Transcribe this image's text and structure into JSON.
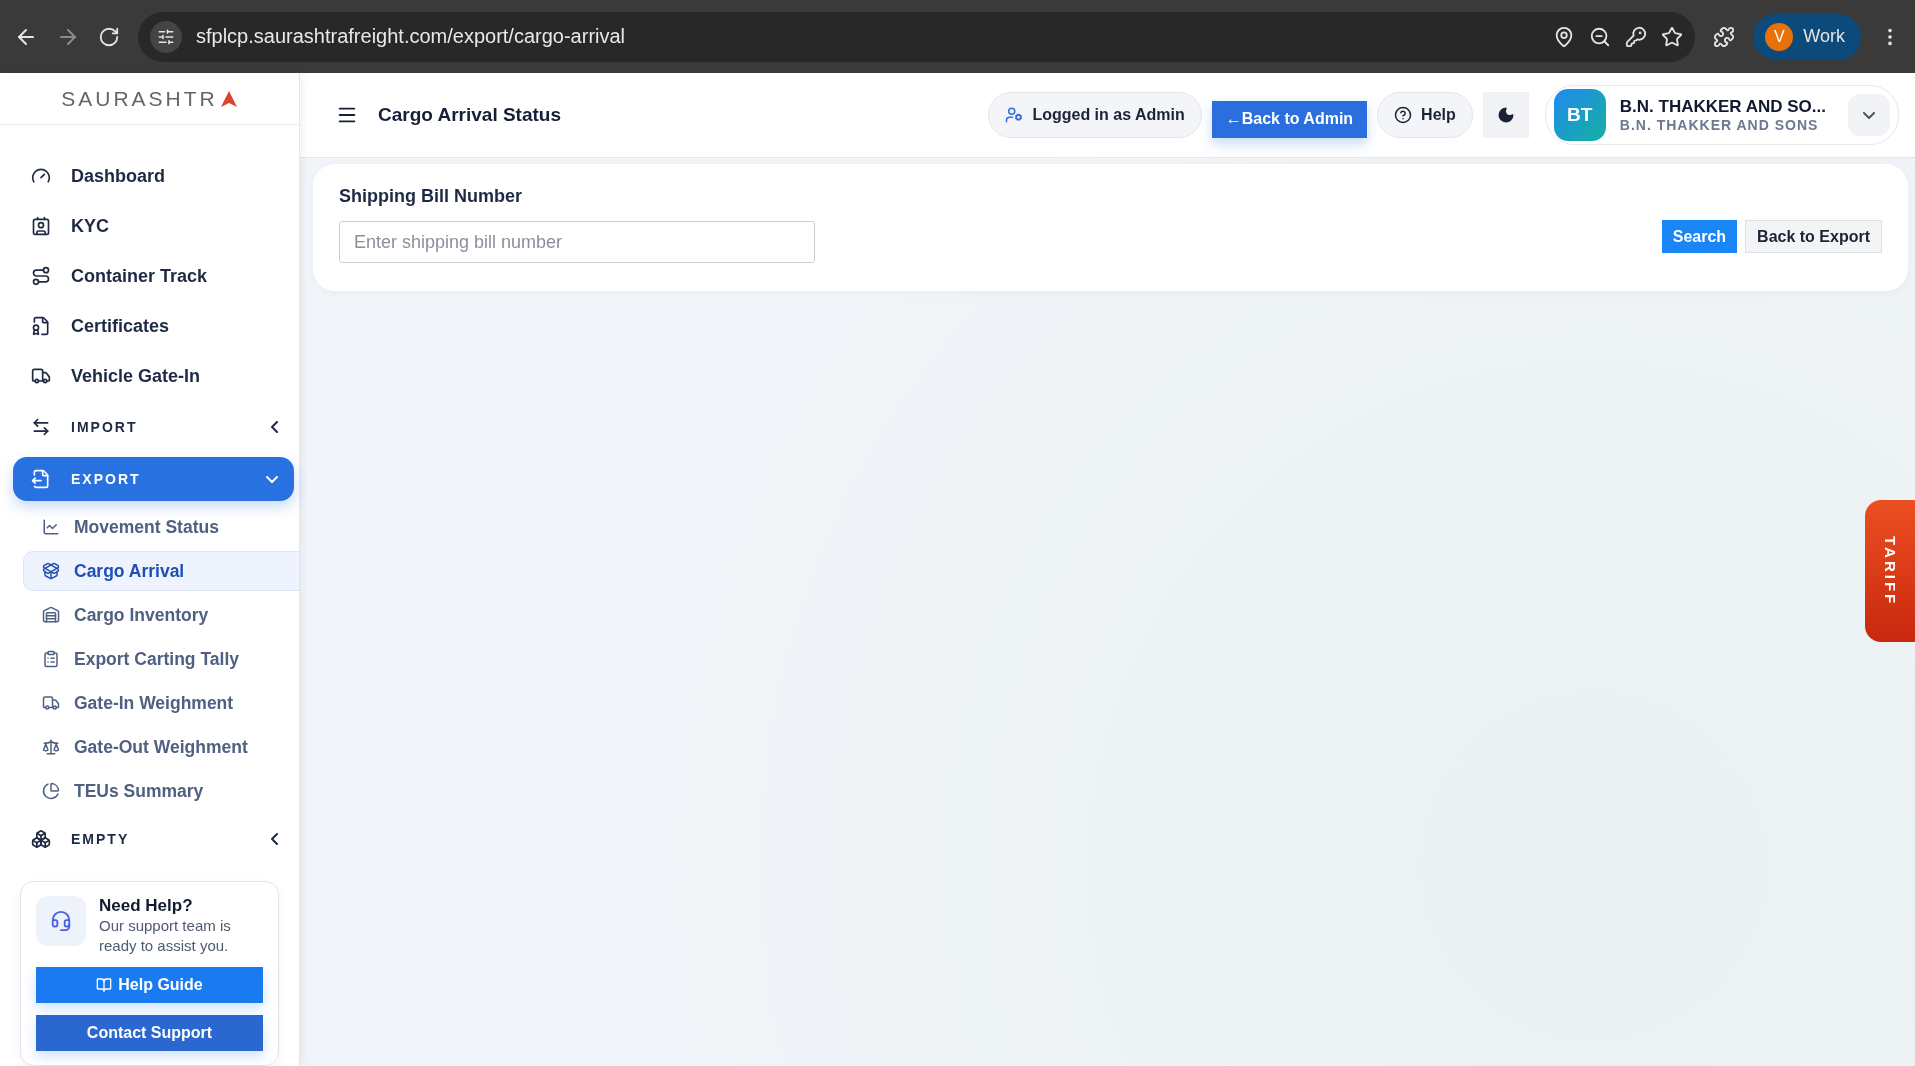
{
  "browser": {
    "url": "sfplcp.saurashtrafreight.com/export/cargo-arrival",
    "profile_initial": "V",
    "profile_name": "Work"
  },
  "sidebar": {
    "logo": "SAURASHTR",
    "items": [
      {
        "kind": "link",
        "label": "Dashboard",
        "selected": false
      },
      {
        "kind": "link",
        "label": "KYC",
        "selected": false
      },
      {
        "kind": "link",
        "label": "Container Track",
        "selected": false
      },
      {
        "kind": "link",
        "label": "Certificates",
        "selected": false
      },
      {
        "kind": "link",
        "label": "Vehicle Gate-In",
        "selected": false
      },
      {
        "kind": "section",
        "label": "IMPORT",
        "selected": false,
        "expanded": false
      },
      {
        "kind": "section",
        "label": "EXPORT",
        "selected": true,
        "expanded": true,
        "children": [
          {
            "label": "Movement Status",
            "selected": false
          },
          {
            "label": "Cargo Arrival",
            "selected": true
          },
          {
            "label": "Cargo Inventory",
            "selected": false
          },
          {
            "label": "Export Carting Tally",
            "selected": false
          },
          {
            "label": "Gate-In Weighment",
            "selected": false
          },
          {
            "label": "Gate-Out Weighment",
            "selected": false
          },
          {
            "label": "TEUs Summary",
            "selected": false
          }
        ]
      },
      {
        "kind": "section",
        "label": "EMPTY",
        "selected": false,
        "expanded": false
      }
    ],
    "help": {
      "title": "Need Help?",
      "text": "Our support team is ready to assist you.",
      "buttons": [
        "Help Guide",
        "Contact Support"
      ]
    }
  },
  "header": {
    "title": "Cargo Arrival Status",
    "logged_in": "Logged in as Admin",
    "back_admin": "←Back to Admin",
    "help": "Help",
    "user": {
      "initials": "BT",
      "name": "B.N. THAKKER AND SO...",
      "company": "B.N. THAKKER AND SONS"
    }
  },
  "form": {
    "label": "Shipping Bill Number",
    "placeholder": "Enter shipping bill number",
    "buttons": [
      "Search",
      "Back to Export"
    ]
  },
  "tariff": "TARIFF"
}
